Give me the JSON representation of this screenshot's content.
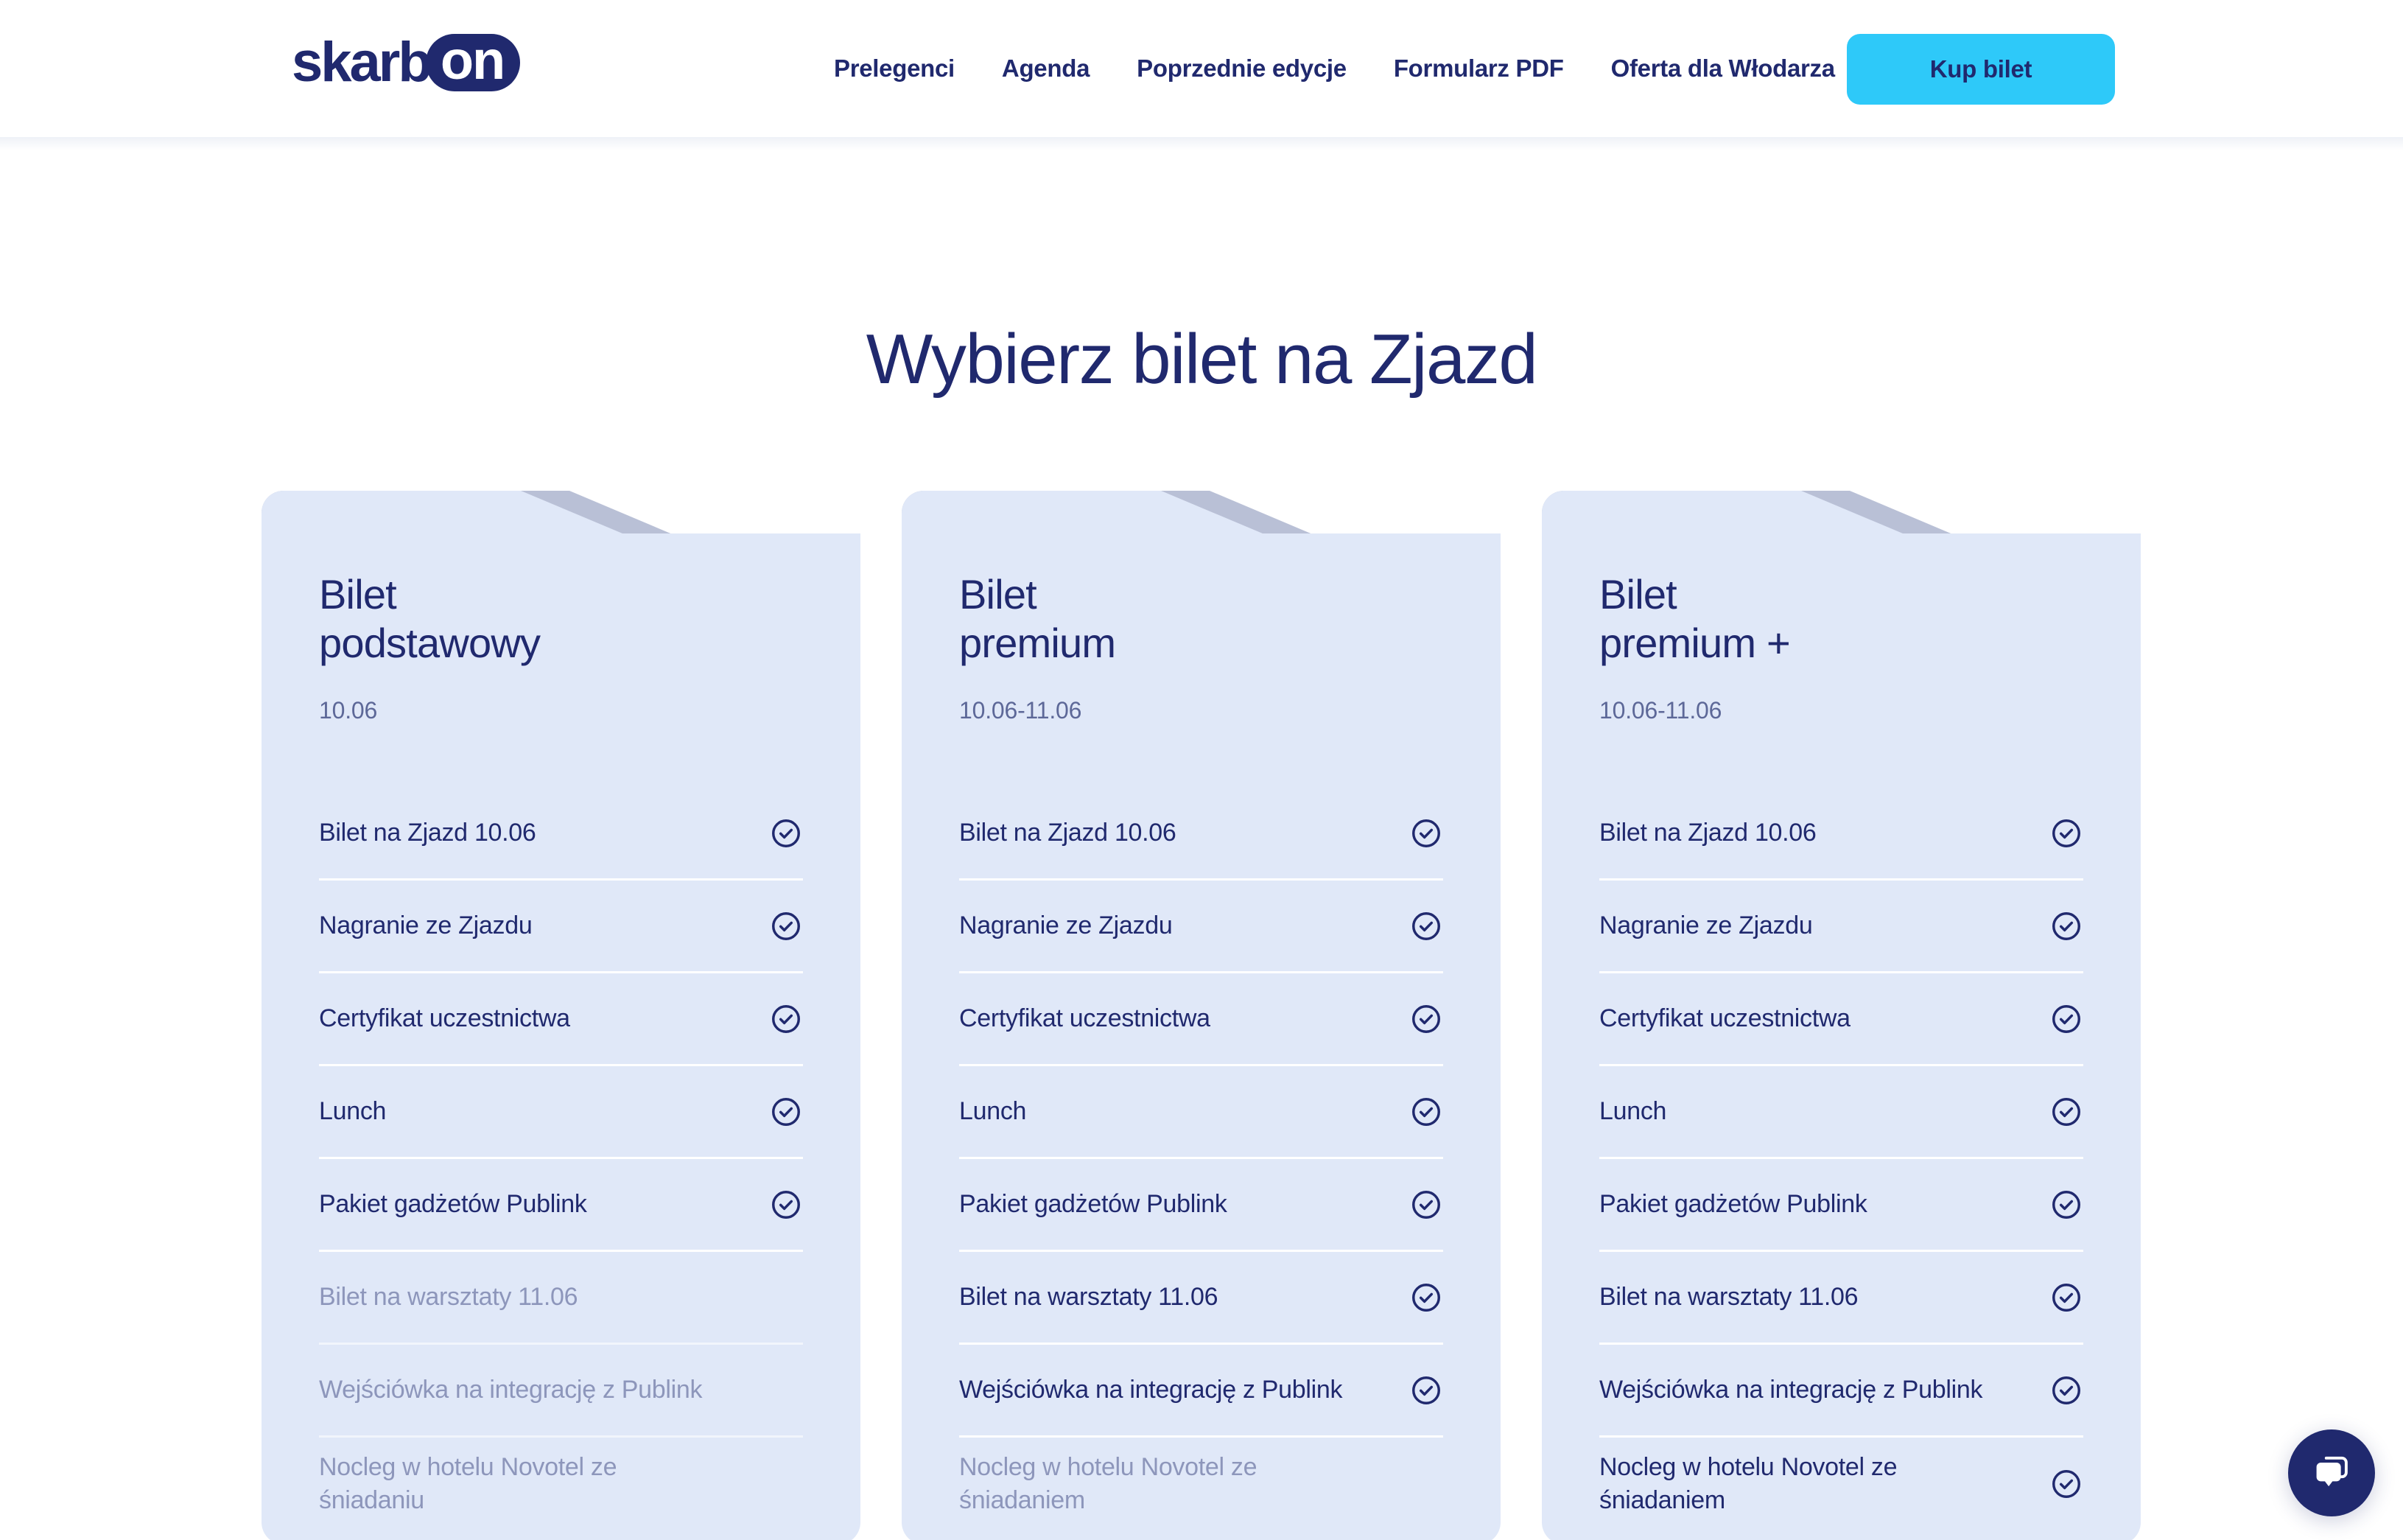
{
  "header": {
    "logo": {
      "word": "skarb",
      "pill": "on"
    },
    "nav": [
      {
        "label": "Prelegenci"
      },
      {
        "label": "Agenda"
      },
      {
        "label": "Poprzednie edycje"
      },
      {
        "label": "Formularz PDF"
      },
      {
        "label": "Oferta dla Włodarza"
      }
    ],
    "cta": {
      "label": "Kup bilet"
    }
  },
  "main": {
    "title": "Wybierz bilet na Zjazd",
    "cards": [
      {
        "title": "Bilet\npodstawowy",
        "date": "10.06",
        "features": [
          {
            "label": "Bilet na Zjazd 10.06",
            "included": true
          },
          {
            "label": "Nagranie ze Zjazdu",
            "included": true
          },
          {
            "label": "Certyfikat uczestnictwa",
            "included": true
          },
          {
            "label": "Lunch",
            "included": true
          },
          {
            "label": "Pakiet gadżetów Publink",
            "included": true
          },
          {
            "label": "Bilet na warsztaty 11.06",
            "included": false
          },
          {
            "label": "Wejściówka na integrację z Publink",
            "included": false
          },
          {
            "label": "Nocleg w hotelu Novotel ze śniadaniu",
            "included": false
          }
        ]
      },
      {
        "title": "Bilet\npremium",
        "date": "10.06-11.06",
        "features": [
          {
            "label": "Bilet na Zjazd 10.06",
            "included": true
          },
          {
            "label": "Nagranie ze Zjazdu",
            "included": true
          },
          {
            "label": "Certyfikat uczestnictwa",
            "included": true
          },
          {
            "label": "Lunch",
            "included": true
          },
          {
            "label": "Pakiet gadżetów Publink",
            "included": true
          },
          {
            "label": "Bilet na warsztaty 11.06",
            "included": true
          },
          {
            "label": "Wejściówka na integrację z Publink",
            "included": true
          },
          {
            "label": "Nocleg w hotelu Novotel ze śniadaniem",
            "included": false
          }
        ]
      },
      {
        "title": "Bilet\npremium +",
        "date": "10.06-11.06",
        "features": [
          {
            "label": "Bilet na Zjazd 10.06",
            "included": true
          },
          {
            "label": "Nagranie ze Zjazdu",
            "included": true
          },
          {
            "label": "Certyfikat uczestnictwa",
            "included": true
          },
          {
            "label": "Lunch",
            "included": true
          },
          {
            "label": "Pakiet gadżetów Publink",
            "included": true
          },
          {
            "label": "Bilet na warsztaty 11.06",
            "included": true
          },
          {
            "label": "Wejściówka na integrację z Publink",
            "included": true
          },
          {
            "label": "Nocleg w hotelu Novotel ze śniadaniem",
            "included": true
          }
        ]
      }
    ]
  },
  "chat": {
    "icon": "chat-bubble-icon"
  },
  "colors": {
    "navy": "#20296e",
    "cyan": "#2ec9f9",
    "card_bg": "#e0e8f8",
    "card_fold": "#b9c0d6",
    "muted_text": "#8d96bb",
    "date_text": "#5d6898"
  }
}
